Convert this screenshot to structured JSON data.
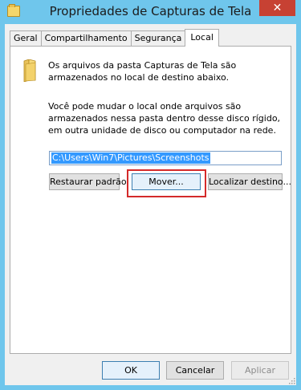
{
  "window": {
    "title": "Propriedades de Capturas de Tela",
    "close_glyph": "✕"
  },
  "tabs": [
    {
      "label": "Geral"
    },
    {
      "label": "Compartilhamento"
    },
    {
      "label": "Segurança"
    },
    {
      "label": "Local",
      "active": true
    }
  ],
  "panel": {
    "info_text": "Os arquivos da pasta Capturas de Tela são armazenados no local de destino abaixo.",
    "description_text": "Você pode mudar o local onde arquivos são armazenados nessa pasta dentro desse disco rígido, em outra unidade de disco ou computador na rede.",
    "path_value": "C:\\Users\\Win7\\Pictures\\Screenshots",
    "restore_label": "Restaurar padrão",
    "move_label": "Mover...",
    "find_target_label": "Localizar destino..."
  },
  "footer": {
    "ok_label": "OK",
    "cancel_label": "Cancelar",
    "apply_label": "Aplicar"
  },
  "colors": {
    "window_frame": "#6fc6ec",
    "close_button": "#c74133",
    "highlight_box": "#d42a2a",
    "selection": "#3399ff"
  }
}
